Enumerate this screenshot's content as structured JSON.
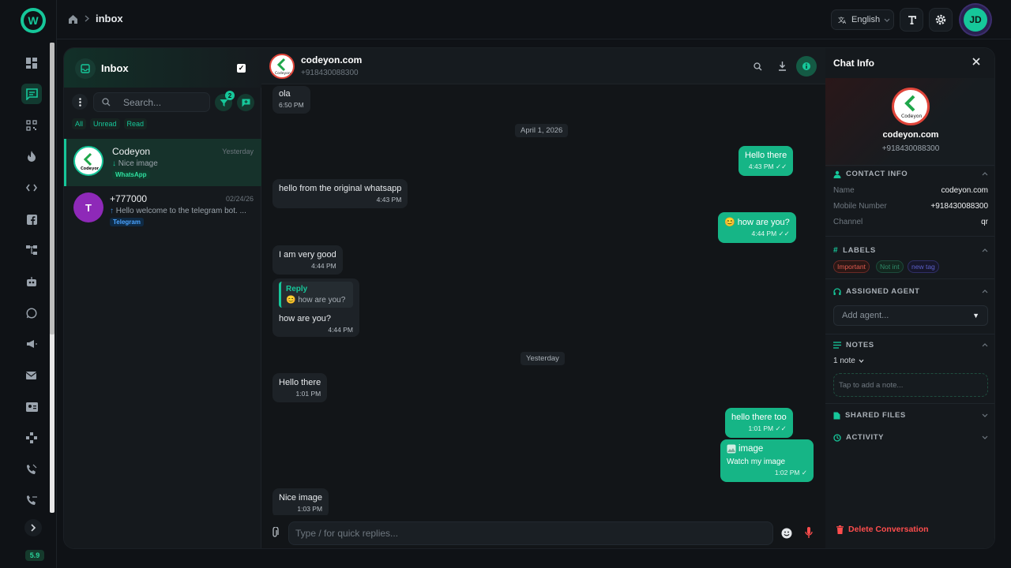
{
  "app": {
    "version": "5.9",
    "logo_letter": "W"
  },
  "breadcrumb": {
    "page": "inbox"
  },
  "topbar": {
    "language": "English",
    "user_initials": "JD"
  },
  "inbox": {
    "title": "Inbox",
    "search_placeholder": "Search...",
    "filter_count": "2",
    "tabs": [
      "All",
      "Unread",
      "Read"
    ],
    "conversations": [
      {
        "name": "Codeyon",
        "time": "Yesterday",
        "preview": "Nice image",
        "direction": "incoming",
        "channel": "WhatsApp",
        "avatar_type": "logo"
      },
      {
        "name": "+777000",
        "time": "02/24/26",
        "preview": "Hello welcome to the telegram bot. ...",
        "direction": "outgoing",
        "channel": "Telegram",
        "avatar_type": "initial",
        "initial": "T"
      }
    ]
  },
  "chat": {
    "name": "codeyon.com",
    "phone": "+918430088300",
    "composer_placeholder": "Type / for quick replies...",
    "logo_text": "Codeyon",
    "date_chips": [
      "April 1, 2026",
      "Yesterday"
    ],
    "messages": [
      {
        "dir": "in",
        "text": "ola",
        "time": "6:50 PM"
      },
      {
        "dir": "out",
        "text": "Hello there",
        "time": "4:43 PM"
      },
      {
        "dir": "in",
        "text": "hello from the original whatsapp",
        "time": "4:43 PM"
      },
      {
        "dir": "out",
        "text": "😊 how are you?",
        "time": "4:44 PM"
      },
      {
        "dir": "in",
        "text": "I am very good",
        "time": "4:44 PM"
      },
      {
        "dir": "in",
        "text": "how are you?",
        "time": "4:44 PM",
        "reply_label": "Reply",
        "reply_text": "😊 how are you?"
      },
      {
        "dir": "in",
        "text": "Hello there",
        "time": "1:01 PM"
      },
      {
        "dir": "out",
        "text": "hello there too",
        "time": "1:01 PM"
      },
      {
        "dir": "out",
        "text": "Watch my image",
        "time": "1:02 PM",
        "image_alt": "image"
      },
      {
        "dir": "in",
        "text": "Nice image",
        "time": "1:03 PM"
      }
    ]
  },
  "info": {
    "title": "Chat Info",
    "name": "codeyon.com",
    "phone": "+918430088300",
    "contact_section": "CONTACT INFO",
    "contact_fields": [
      {
        "key": "Name",
        "value": "codeyon.com"
      },
      {
        "key": "Mobile Number",
        "value": "+918430088300"
      },
      {
        "key": "Channel",
        "value": "qr"
      }
    ],
    "labels_section": "LABELS",
    "labels": [
      {
        "text": "Important",
        "color": "#e05a4f"
      },
      {
        "text": "Not int",
        "color": "#2f8a6a"
      },
      {
        "text": "new tag",
        "color": "#5b5fc7"
      }
    ],
    "agent_section": "ASSIGNED AGENT",
    "agent_placeholder": "Add agent...",
    "notes_section": "NOTES",
    "notes_count": "1 note",
    "note_placeholder": "Tap to add a note...",
    "files_section": "SHARED FILES",
    "activity_section": "ACTIVITY",
    "delete_label": "Delete Conversation"
  },
  "colors": {
    "accent": "#16c79a",
    "danger": "#ff4d4d",
    "bubble_out": "#16b586",
    "bubble_in": "#1d2227"
  }
}
